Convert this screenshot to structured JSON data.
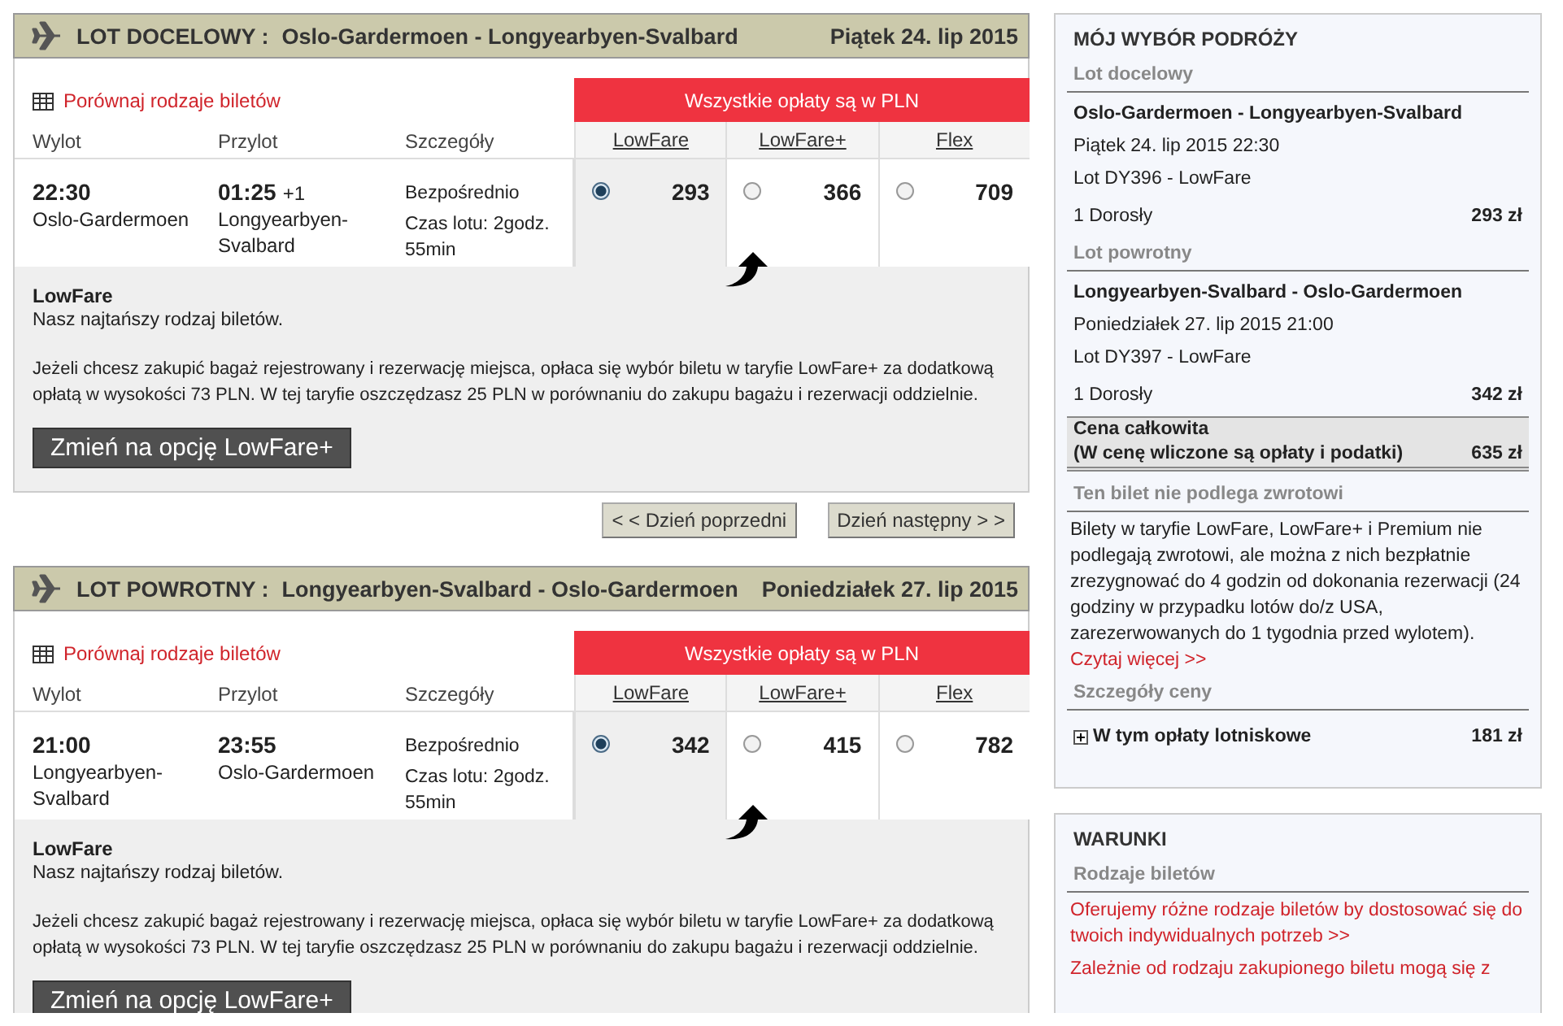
{
  "flights": [
    {
      "label": "LOT DOCELOWY :",
      "route": "Oslo-Gardermoen - Longyearbyen-Svalbard",
      "date": "Piątek 24. lip 2015",
      "compare_link": "Porównaj rodzaje biletów",
      "headers": [
        "Wylot",
        "Przylot",
        "Szczegóły"
      ],
      "fare_banner": "Wszystkie opłaty są w PLN",
      "fares": [
        {
          "name": "LowFare",
          "price": "293",
          "selected": true
        },
        {
          "name": "LowFare+",
          "price": "366",
          "selected": false
        },
        {
          "name": "Flex",
          "price": "709",
          "selected": false
        }
      ],
      "departure": {
        "time": "22:30",
        "place": "Oslo-Gardermoen"
      },
      "arrival": {
        "time": "01:25",
        "day_offset": "+1",
        "place": "Longyearbyen-Svalbard"
      },
      "details": [
        "Bezpośrednio",
        "Czas lotu: 2godz. 55min"
      ],
      "info": {
        "title": "LowFare",
        "subtitle": "Nasz najtańszy rodzaj biletów.",
        "text": "Jeżeli chcesz zakupić bagaż rejestrowany i rezerwację miejsca, opłaca się wybór biletu w taryfie LowFare+ za dodatkową opłatą w wysokości 73 PLN. W tej taryfie oszczędzasz 25 PLN w porównaniu do zakupu bagażu i rezerwacji oddzielnie.",
        "button": "Zmień na opcję LowFare+"
      }
    },
    {
      "label": "LOT POWROTNY :",
      "route": "Longyearbyen-Svalbard - Oslo-Gardermoen",
      "date": "Poniedziałek 27. lip 2015",
      "compare_link": "Porównaj rodzaje biletów",
      "headers": [
        "Wylot",
        "Przylot",
        "Szczegóły"
      ],
      "fare_banner": "Wszystkie opłaty są w PLN",
      "fares": [
        {
          "name": "LowFare",
          "price": "342",
          "selected": true
        },
        {
          "name": "LowFare+",
          "price": "415",
          "selected": false
        },
        {
          "name": "Flex",
          "price": "782",
          "selected": false
        }
      ],
      "departure": {
        "time": "21:00",
        "place": "Longyearbyen-Svalbard"
      },
      "arrival": {
        "time": "23:55",
        "place": "Oslo-Gardermoen"
      },
      "details": [
        "Bezpośrednio",
        "Czas lotu: 2godz. 55min"
      ],
      "info": {
        "title": "LowFare",
        "subtitle": "Nasz najtańszy rodzaj biletów.",
        "text": "Jeżeli chcesz zakupić bagaż rejestrowany i rezerwację miejsca, opłaca się wybór biletu w taryfie LowFare+ za dodatkową opłatą w wysokości 73 PLN. W tej taryfie oszczędzasz 25 PLN w porównaniu do zakupu bagażu i rezerwacji oddzielnie.",
        "button": "Zmień na opcję LowFare+"
      }
    }
  ],
  "day_nav": {
    "previous": "< < Dzień poprzedni",
    "next": "Dzień następny > >"
  },
  "summary": {
    "title": "MÓJ WYBÓR PODRÓŻY",
    "legs": [
      {
        "heading": "Lot docelowy",
        "route": "Oslo-Gardermoen - Longyearbyen-Svalbard",
        "datetime": "Piątek 24. lip 2015 22:30",
        "flight": "Lot DY396 - LowFare",
        "passengers": "1 Dorosły",
        "price": "293 zł"
      },
      {
        "heading": "Lot powrotny",
        "route": "Longyearbyen-Svalbard - Oslo-Gardermoen",
        "datetime": "Poniedziałek 27. lip 2015 21:00",
        "flight": "Lot DY397 - LowFare",
        "passengers": "1 Dorosły",
        "price": "342 zł"
      }
    ],
    "total": {
      "label": "Cena całkowita",
      "note": "(W cenę wliczone są opłaty i podatki)",
      "price": "635 zł"
    },
    "refund": {
      "heading": "Ten bilet nie podlega zwrotowi",
      "text": "Bilety w taryfie LowFare, LowFare+ i Premium nie podlegają zwrotowi, ale można z nich bezpłatnie zrezygnować do 4 godzin od dokonania rezerwacji (24 godziny w przypadku lotów do/z USA, zarezerwowanych do 1 tygodnia przed wylotem).",
      "link": "Czytaj więcej >>"
    },
    "price_details": {
      "heading": "Szczegóły ceny",
      "label": "W tym opłaty lotniskowe",
      "price": "181 zł",
      "expanded": false
    }
  },
  "conditions": {
    "title": "WARUNKI",
    "heading": "Rodzaje biletów",
    "links": [
      "Oferujemy różne rodzaje biletów by dostosować się do twoich indywidualnych potrzeb >>",
      "Zależnie od rodzaju zakupionego biletu mogą się z"
    ]
  }
}
